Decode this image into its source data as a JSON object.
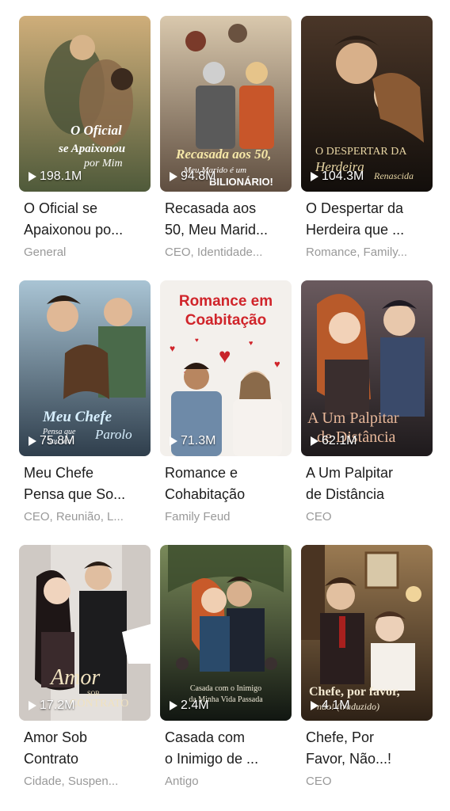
{
  "dramas": [
    {
      "title_line1": "O Oficial se",
      "title_line2": "Apaixonou po...",
      "tags": "General",
      "views": "198.1M",
      "cover_text": "O Oficial se Apaixonou por Mim",
      "cover_colors": [
        "#c49a68",
        "#6f7a52"
      ]
    },
    {
      "title_line1": "Recasada aos",
      "title_line2": "50, Meu Marid...",
      "tags": "CEO, Identidade...",
      "views": "94.8M",
      "cover_text": "Recasada aos 50, Meu Marido é um BILIONÁRIO!",
      "cover_colors": [
        "#d9c2a3",
        "#6b5a4a"
      ]
    },
    {
      "title_line1": "O Despertar da",
      "title_line2": "Herdeira que ...",
      "tags": "Romance, Family...",
      "views": "104.3M",
      "cover_text": "O Despertar da Herdeira Renascida",
      "cover_colors": [
        "#3b2a20",
        "#1a1410"
      ]
    },
    {
      "title_line1": "Meu Chefe",
      "title_line2": "Pensa que So...",
      "tags": "CEO, Reunião, L...",
      "views": "75.8M",
      "cover_text": "Meu Chefe Pensa que Sou um Parolo",
      "cover_colors": [
        "#9bb7c9",
        "#39495a"
      ]
    },
    {
      "title_line1": "Romance e",
      "title_line2": "Cohabitação",
      "tags": "Family Feud",
      "views": "71.3M",
      "cover_text": "Romance em Coabitação",
      "cover_colors": [
        "#f4f1ee",
        "#d8d2cc"
      ]
    },
    {
      "title_line1": "A Um Palpitar",
      "title_line2": "de Distância",
      "tags": "CEO",
      "views": "62.1M",
      "cover_text": "A Um Palpitar de Distância",
      "cover_colors": [
        "#5a4a4e",
        "#2a2226"
      ]
    },
    {
      "title_line1": "Amor Sob",
      "title_line2": "Contrato",
      "tags": "Cidade, Suspen...",
      "views": "17.2M",
      "cover_text": "Amor sob Contrato",
      "cover_colors": [
        "#e6e2de",
        "#3a3434"
      ]
    },
    {
      "title_line1": "Casada com",
      "title_line2": "o Inimigo de ...",
      "tags": "Antigo",
      "views": "2.4M",
      "cover_text": "Casada com o Inimigo da Minha Vida Passada",
      "cover_colors": [
        "#6a7f5a",
        "#1e2a1e"
      ]
    },
    {
      "title_line1": "Chefe, Por",
      "title_line2": "Favor, Não...!",
      "tags": "CEO",
      "views": "4.1M",
      "cover_text": "Chefe, por favor, não! (traduzido)",
      "cover_colors": [
        "#8a6a48",
        "#3a2a1c"
      ]
    }
  ]
}
